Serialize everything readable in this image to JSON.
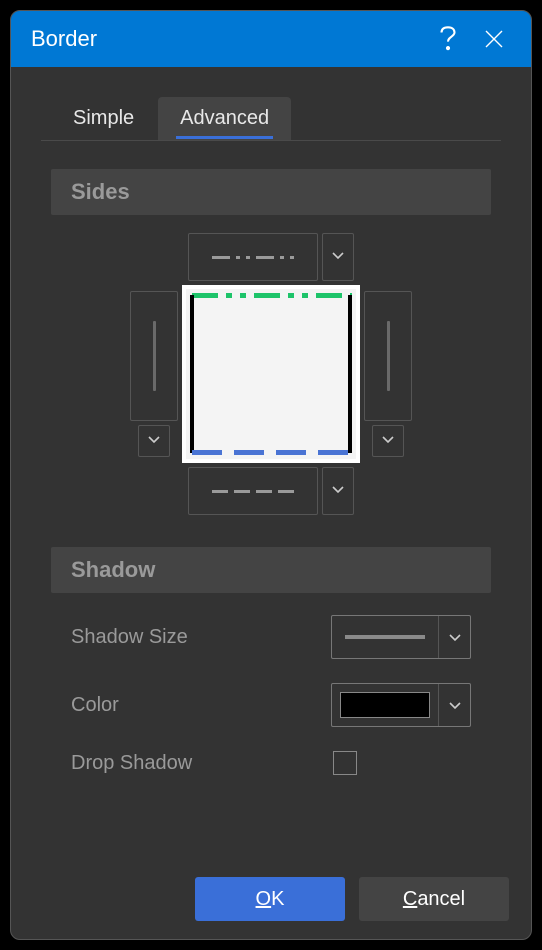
{
  "window": {
    "title": "Border"
  },
  "tabs": {
    "simple": "Simple",
    "advanced": "Advanced",
    "active": "advanced"
  },
  "sections": {
    "sides": "Sides",
    "shadow": "Shadow"
  },
  "sides": {
    "top_style": "dash-dot-dot",
    "bottom_style": "dashed",
    "left_style": "solid",
    "right_style": "solid",
    "preview": {
      "top_color": "#1ec46a",
      "bottom_color": "#4a74d4",
      "left_color": "#000000",
      "right_color": "#000000"
    }
  },
  "shadow": {
    "size_label": "Shadow Size",
    "color_label": "Color",
    "drop_label": "Drop Shadow",
    "color_value": "#000000",
    "drop_checked": false
  },
  "buttons": {
    "ok": "OK",
    "ok_ul": "O",
    "ok_rest": "K",
    "cancel": "Cancel",
    "cancel_ul": "C",
    "cancel_rest": "ancel"
  },
  "icons": {
    "help": "?",
    "close": "×",
    "chevron": "˅"
  }
}
